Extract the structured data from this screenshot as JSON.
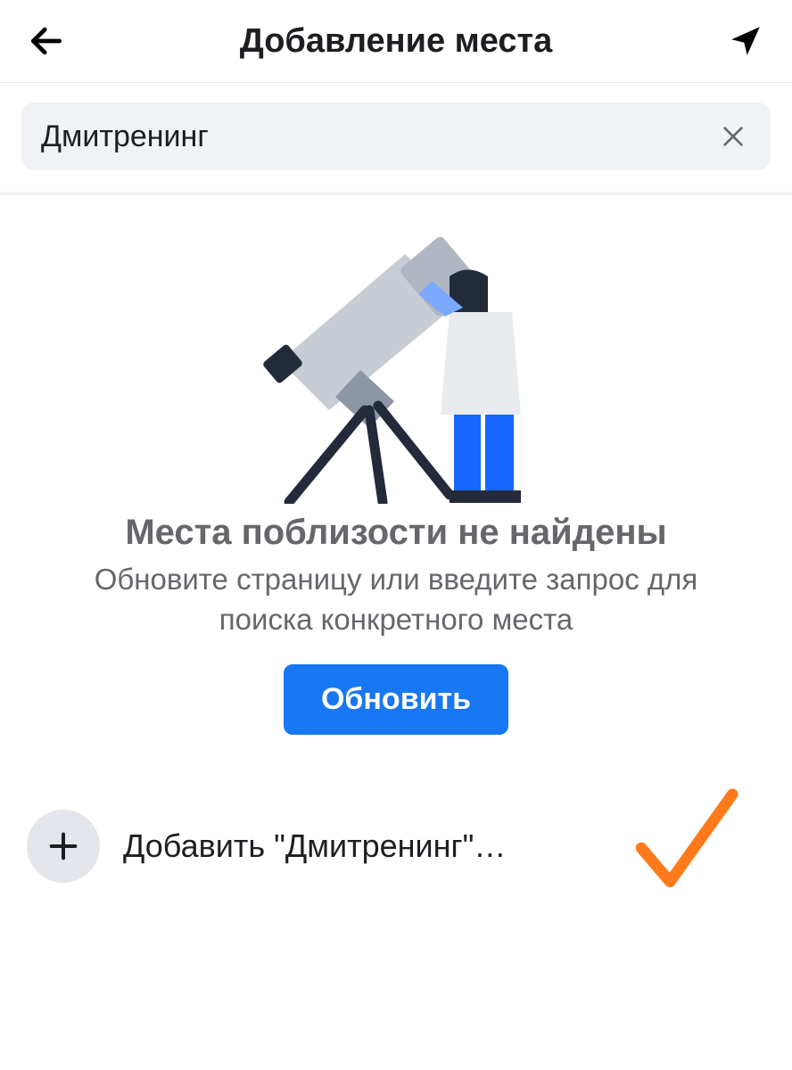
{
  "header": {
    "title": "Добавление места"
  },
  "search": {
    "value": "Дмитренинг"
  },
  "empty": {
    "title": "Места поблизости не найдены",
    "subtitle": "Обновите страницу или введите запрос для поиска конкретного места",
    "button": "Обновить"
  },
  "add": {
    "label": "Добавить \"Дмитренинг\"…"
  }
}
